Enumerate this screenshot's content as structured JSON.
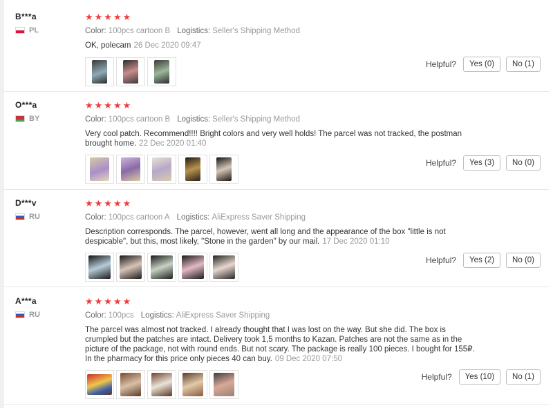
{
  "feedback": {
    "stars": "★★★★★",
    "color_key": "Color:",
    "logistics_key": "Logistics:",
    "helpful_label": "Helpful?",
    "reviews": [
      {
        "user": "B***a",
        "country": "PL",
        "color": "100pcs cartoon B",
        "logistics": "Seller's Shipping Method",
        "text": "OK, polecam",
        "date": "26 Dec 2020 09:47",
        "yes": "Yes (0)",
        "no": "No (1)"
      },
      {
        "user": "O***a",
        "country": "BY",
        "color": "100pcs cartoon B",
        "logistics": "Seller's Shipping Method",
        "text": "Very cool patch. Recommend!!!! Bright colors and very well holds! The parcel was not tracked, the postman brought home.",
        "date": "22 Dec 2020 01:40",
        "yes": "Yes (3)",
        "no": "No (0)"
      },
      {
        "user": "D***v",
        "country": "RU",
        "color": "100pcs cartoon A",
        "logistics": "AliExpress Saver Shipping",
        "text": "Description corresponds. The parcel, however, went all long and the appearance of the box \"little is not despicable\", but this, most likely, \"Stone in the garden\" by our mail.",
        "date": "17 Dec 2020 01:10",
        "yes": "Yes (2)",
        "no": "No (0)"
      },
      {
        "user": "A***a",
        "country": "RU",
        "color": "100pcs",
        "logistics": "AliExpress Saver Shipping",
        "text": "The parcel was almost not tracked. I already thought that I was lost on the way. But she did. The box is crumpled but the patches are intact. Delivery took 1,5 months to Kazan. Patches are not the same as in the picture of the package, not with round ends. But not scary. The package is really 100 pieces. I bought for 155₽. In the pharmacy for this price only pieces 40 can buy.",
        "date": "09 Dec 2020 07:50",
        "yes": "Yes (10)",
        "no": "No (1)"
      }
    ]
  }
}
